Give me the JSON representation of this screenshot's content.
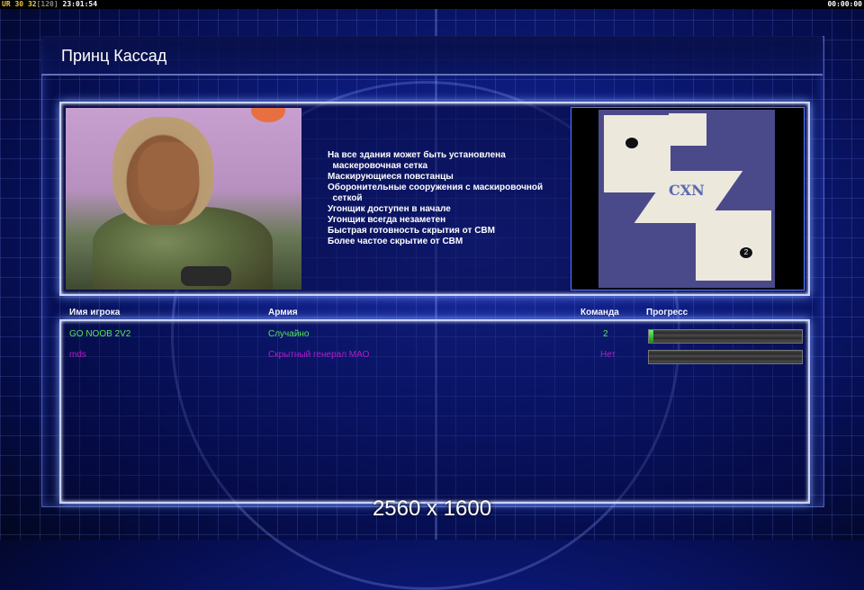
{
  "statusbar": {
    "ur_label": "UR",
    "fps_a": "30",
    "fps_b": "32",
    "fps_cap": "[120]",
    "clock_left": "23:01:54",
    "clock_right": "00:00:00"
  },
  "title": "Принц Кассад",
  "perks": [
    "На все здания может быть установлена",
    "  маскеровочная сетка",
    "Маскирующиеся повстанцы",
    "Оборонительные сооружения с маскировочной",
    "  сеткой",
    "Угонщик доступен в начале",
    "Угонщик всегда незаметен",
    "Быстрая готовность скрытия от СВМ",
    "Более частое скрытие от СВМ"
  ],
  "map": {
    "spawn_1": "",
    "spawn_2": "2",
    "label": "CXN"
  },
  "table": {
    "col_name": "Имя игрока",
    "col_army": "Армия",
    "col_team": "Команда",
    "col_progress": "Прогресс",
    "rows": [
      {
        "name": "GO NOOB 2V2",
        "army": "Случайно",
        "team": "2",
        "progress": 0.03,
        "color": "#55e855"
      },
      {
        "name": "mds",
        "army": "Скрытный генерал МАО",
        "team": "Нет",
        "progress": 0,
        "color": "#b01ec8"
      }
    ]
  },
  "resolution": "2560 x 1600",
  "colors": {
    "accent_glow": "#7fa0ff",
    "background": "#0c1a7a"
  }
}
